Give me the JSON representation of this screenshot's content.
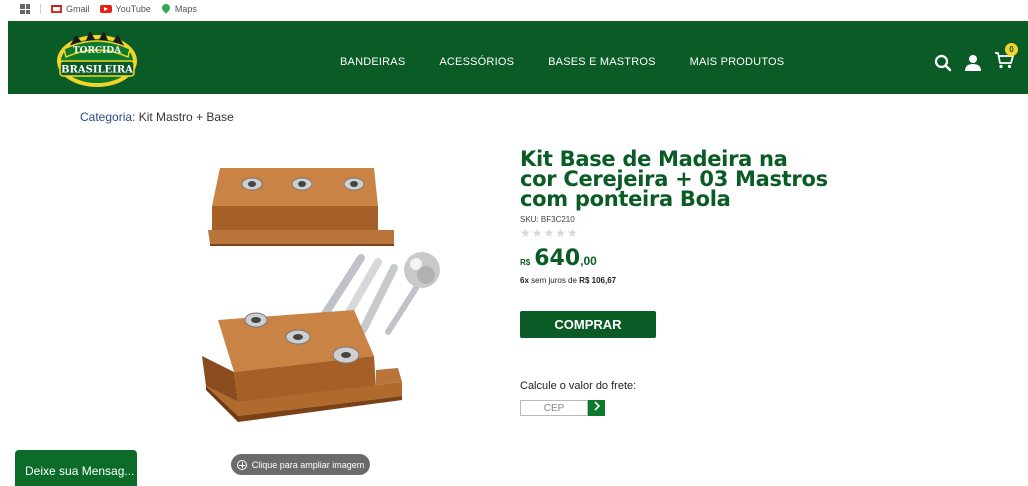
{
  "bookmarks": [
    {
      "label": "Gmail",
      "icon": "gmail-icon"
    },
    {
      "label": "YouTube",
      "icon": "youtube-icon"
    },
    {
      "label": "Maps",
      "icon": "maps-icon"
    }
  ],
  "header": {
    "logo_top": "TORCIDA",
    "logo_bottom": "BRASILEIRA",
    "nav": [
      "BANDEIRAS",
      "ACESSÓRIOS",
      "BASES E MASTROS",
      "MAIS PRODUTOS"
    ],
    "cart_count": "0"
  },
  "breadcrumb": {
    "label": "Categoria:",
    "value": "Kit Mastro + Base"
  },
  "product": {
    "title": "Kit Base de Madeira na cor Cerejeira + 03 Mastros com ponteira Bola",
    "sku": "SKU: BF3C210",
    "stars": "★★★★★",
    "rating": 0,
    "currency": "R$",
    "price_int": "640",
    "price_dec": ",00",
    "installments_count": "6x",
    "installments_text": "sem juros de",
    "installments_value": "R$ 106,67",
    "buy_label": "COMPRAR",
    "zoom_label": "Clique para ampliar imagem"
  },
  "shipping": {
    "label": "Calcule o valor do frete:",
    "placeholder": "CEP"
  },
  "chat": {
    "label": "Deixe sua Mensag..."
  },
  "colors": {
    "brand_green": "#0b5b26",
    "wood": "#b06a2e",
    "badge_yellow": "#f3d429"
  }
}
